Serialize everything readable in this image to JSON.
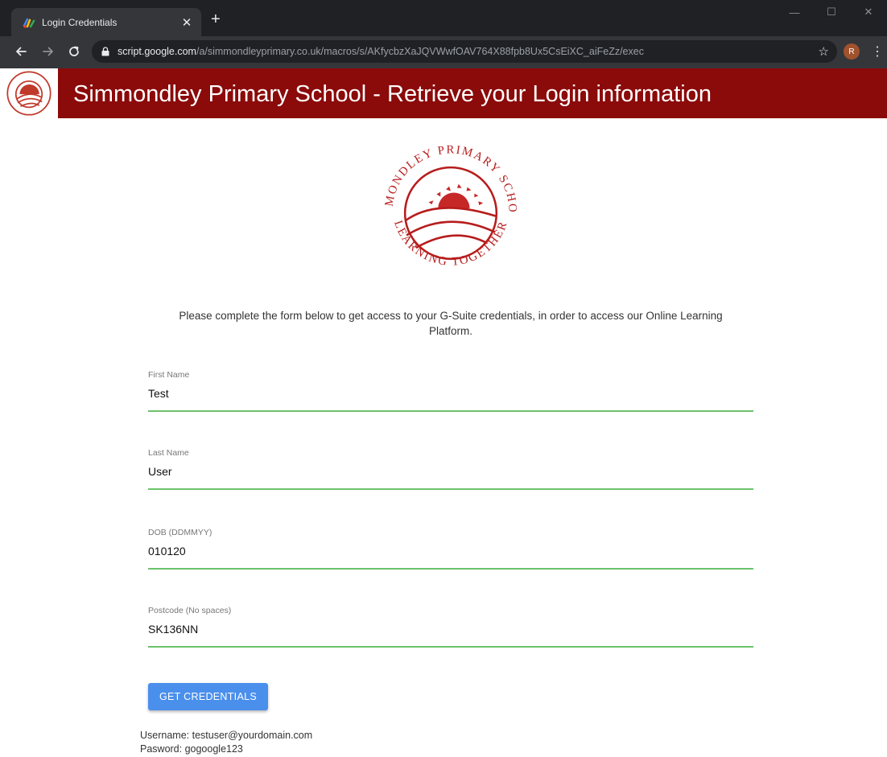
{
  "browser": {
    "tab_title": "Login Credentials",
    "new_tab_symbol": "+",
    "url_host": "script.google.com",
    "url_path": "/a/simmondleyprimary.co.uk/macros/s/AKfycbzXaJQVWwfOAV764X88fpb8Ux5CsEiXC_aiFeZz/exec",
    "profile_initial": "R",
    "icons": [
      "apps-script-favicon",
      "close-tab-icon",
      "back-arrow-icon",
      "forward-arrow-icon",
      "reload-icon",
      "lock-icon",
      "star-icon",
      "menu-icon"
    ]
  },
  "page": {
    "banner_title": "Simmondley Primary School - Retrieve your Login information",
    "brand_color": "#8b0a0a",
    "crest": {
      "top_text": "SIMMONDLEY PRIMARY SCHOOL",
      "bottom_text": "LEARNING TOGETHER"
    },
    "intro": "Please complete the form below to get access to your G-Suite credentials, in order to access our Online Learning Platform.",
    "form": {
      "first_name": {
        "label": "First Name",
        "value": "Test"
      },
      "last_name": {
        "label": "Last Name",
        "value": "User"
      },
      "dob": {
        "label": "DOB (DDMMYY)",
        "value": "010120"
      },
      "postcode": {
        "label": "Postcode (No spaces)",
        "value": "SK136NN"
      },
      "submit_label": "GET CREDENTIALS"
    },
    "result": {
      "username_line": "Username: testuser@yourdomain.com",
      "password_line": "Pasword: gogoogle123"
    }
  }
}
